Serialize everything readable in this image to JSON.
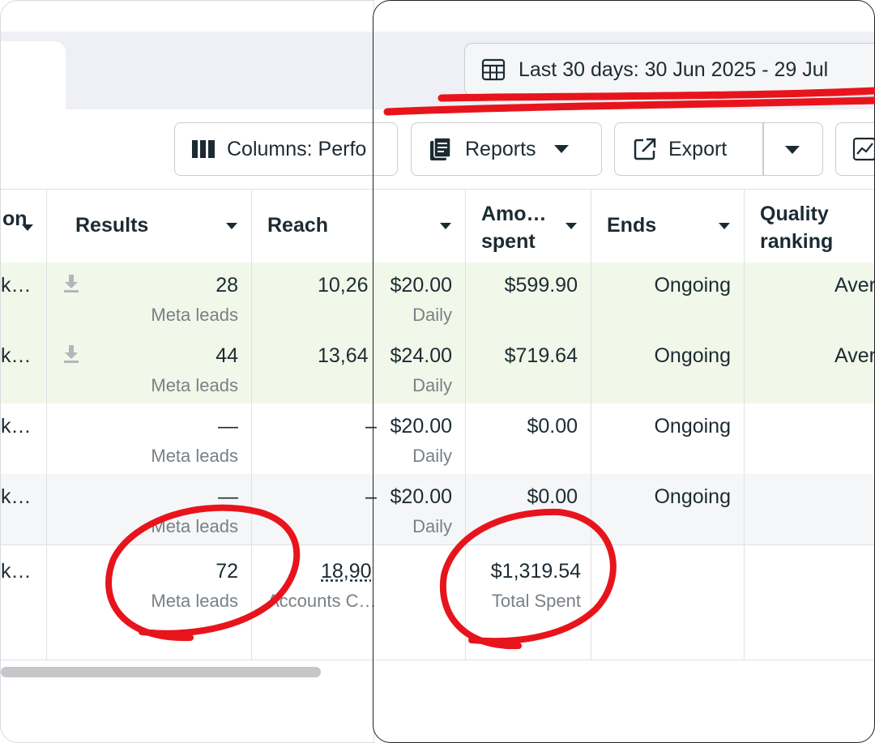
{
  "date_range": {
    "label": "Last 30 days: 30 Jun 2025 - 29 Jul"
  },
  "toolbar": {
    "columns_label": "Columns: Perfo",
    "reports_label": "Reports",
    "export_label": "Export"
  },
  "table": {
    "headers": {
      "campaign": "on",
      "results": "Results",
      "reach": "Reach",
      "amount_spent_line1": "Amo…",
      "amount_spent_line2": "spent",
      "ends": "Ends",
      "quality_line1": "Quality",
      "quality_line2": "ranking"
    },
    "rows": [
      {
        "name": "k…",
        "results": "28",
        "results_sub": "Meta leads",
        "reach": "10,26",
        "budget": "$20.00",
        "budget_sub": "Daily",
        "spent": "$599.90",
        "ends": "Ongoing",
        "quality": "Aver"
      },
      {
        "name": "k…",
        "results": "44",
        "results_sub": "Meta leads",
        "reach": "13,64",
        "budget": "$24.00",
        "budget_sub": "Daily",
        "spent": "$719.64",
        "ends": "Ongoing",
        "quality": "Aver"
      },
      {
        "name": "k…",
        "results": "—",
        "results_sub": "Meta leads",
        "reach": "–",
        "budget": "$20.00",
        "budget_sub": "Daily",
        "spent": "$0.00",
        "ends": "Ongoing",
        "quality": ""
      },
      {
        "name": "k…",
        "results": "—",
        "results_sub": "Meta leads",
        "reach": "–",
        "budget": "$20.00",
        "budget_sub": "Daily",
        "spent": "$0.00",
        "ends": "Ongoing",
        "quality": ""
      }
    ],
    "total": {
      "name": "k…",
      "results": "72",
      "results_sub": "Meta leads",
      "reach": "18,90",
      "reach_sub": "Accounts C…",
      "spent": "$1,319.54",
      "spent_sub": "Total Spent"
    }
  },
  "colors": {
    "row_highlight": "#f1f8e9",
    "row_alt": "#f5f6f7",
    "annotation": "#e8141c"
  }
}
